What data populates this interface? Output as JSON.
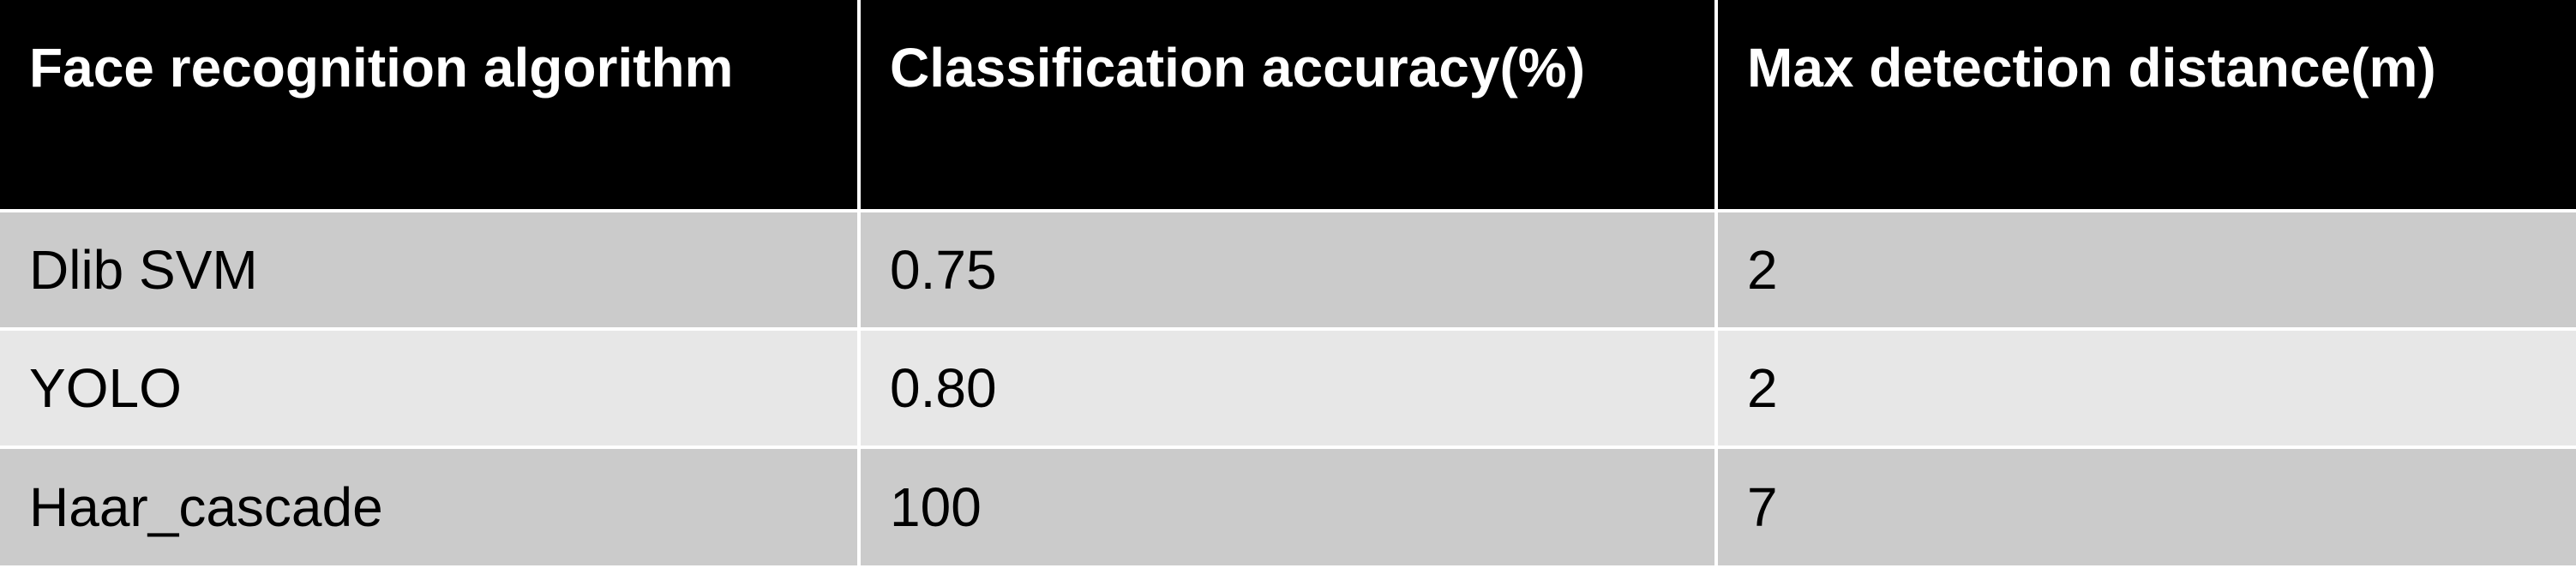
{
  "chart_data": {
    "type": "table",
    "columns": [
      "Face recognition algorithm",
      "Classification accuracy(%)",
      "Max detection distance(m)"
    ],
    "rows": [
      [
        "Dlib SVM",
        "0.75",
        "2"
      ],
      [
        "YOLO",
        "0.80",
        "2"
      ],
      [
        "Haar_cascade",
        "100",
        "7"
      ]
    ],
    "colors": {
      "header_bg": "#000000",
      "header_text": "#ffffff",
      "row_odd_bg": "#cbcbcb",
      "row_even_bg": "#e7e7e7",
      "grid_line": "#ffffff"
    }
  }
}
